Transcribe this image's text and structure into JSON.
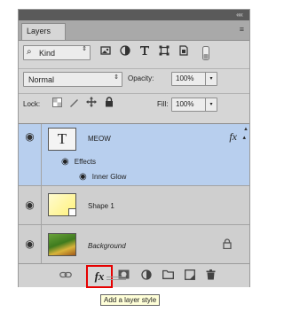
{
  "panel": {
    "collapse_glyph": "««",
    "tab_label": "Layers",
    "menu_glyph": "≡"
  },
  "filter_row": {
    "search_glyph": "⌕",
    "filter_value": "Kind",
    "spin_glyph": "⇕",
    "icons": [
      "image-filter-icon",
      "adjustment-filter-icon",
      "type-filter-icon",
      "shape-filter-icon",
      "smart-object-filter-icon",
      "filter-toggle-icon"
    ]
  },
  "mode_row": {
    "blend_mode": "Normal",
    "spin_glyph": "⇕",
    "opacity_label": "Opacity:",
    "opacity_value": "100%",
    "drop_glyph": "▾"
  },
  "lock_row": {
    "lock_label": "Lock:",
    "fill_label": "Fill:",
    "fill_value": "100%",
    "drop_glyph": "▾"
  },
  "layers": [
    {
      "name": "MEOW",
      "selected": true,
      "thumb_glyph": "T",
      "fx_label": "fx",
      "arrow_glyph": "▴",
      "effects_label": "Effects",
      "inner_glow_label": "Inner Glow"
    },
    {
      "name": "Shape 1",
      "selected": false
    },
    {
      "name": "Background",
      "selected": false,
      "italic": true
    }
  ],
  "eye_glyph": "◉",
  "footer": {
    "fx_label": "fx",
    "tooltip": "Add a layer style"
  },
  "colors": {
    "panel_bg": "#d6d6d6",
    "selected_row": "#b8cfee",
    "highlight_border": "#e60000",
    "tooltip_bg": "#ffffd8"
  }
}
